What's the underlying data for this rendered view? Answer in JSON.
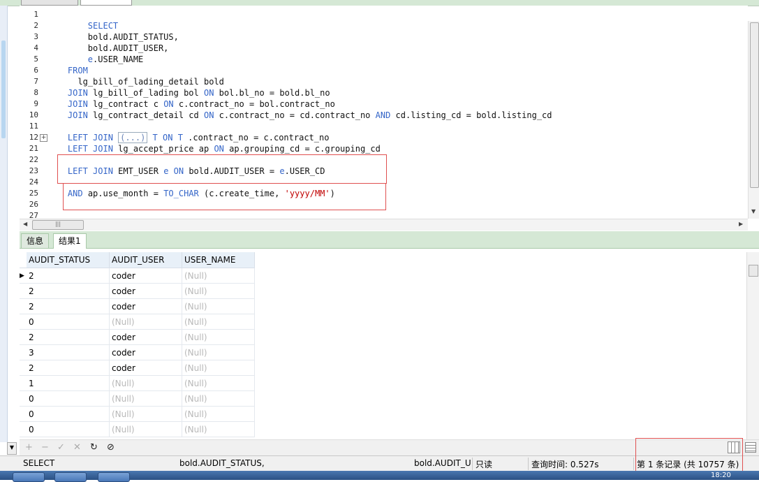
{
  "editor": {
    "line_numbers": [
      "1",
      "2",
      "3",
      "4",
      "5",
      "6",
      "7",
      "8",
      "9",
      "10",
      "11",
      "12",
      "21",
      "22",
      "23",
      "24",
      "25",
      "26",
      "27"
    ],
    "lines": [
      [],
      [
        {
          "t": "        "
        },
        {
          "t": "SELECT",
          "k": true
        }
      ],
      [
        {
          "t": "        bold.AUDIT_STATUS,"
        }
      ],
      [
        {
          "t": "        bold.AUDIT_USER,"
        }
      ],
      [
        {
          "t": "        "
        },
        {
          "t": "e",
          "k": true
        },
        {
          "t": ".USER_NAME"
        }
      ],
      [
        {
          "t": "    "
        },
        {
          "t": "FROM",
          "k": true
        }
      ],
      [
        {
          "t": "      lg_bill_of_lading_detail bold"
        }
      ],
      [
        {
          "t": "    "
        },
        {
          "t": "JOIN",
          "k": true
        },
        {
          "t": " lg_bill_of_lading bol "
        },
        {
          "t": "ON",
          "k": true
        },
        {
          "t": " bol.bl_no = bold.bl_no"
        }
      ],
      [
        {
          "t": "    "
        },
        {
          "t": "JOIN",
          "k": true
        },
        {
          "t": " lg_contract c "
        },
        {
          "t": "ON",
          "k": true
        },
        {
          "t": " c.contract_no = bol.contract_no"
        }
      ],
      [
        {
          "t": "    "
        },
        {
          "t": "JOIN",
          "k": true
        },
        {
          "t": " lg_contract_detail cd "
        },
        {
          "t": "ON",
          "k": true
        },
        {
          "t": " c.contract_no = cd.contract_no "
        },
        {
          "t": "AND",
          "k": true
        },
        {
          "t": " cd.listing_cd = bold.listing_cd"
        }
      ],
      [],
      [
        {
          "t": "    "
        },
        {
          "t": "LEFT JOIN",
          "k": true
        },
        {
          "t": " "
        },
        {
          "t": "(...)",
          "b": true
        },
        {
          "t": " "
        },
        {
          "t": "T",
          "k": true
        },
        {
          "t": " "
        },
        {
          "t": "ON",
          "k": true
        },
        {
          "t": " "
        },
        {
          "t": "T",
          "k": true
        },
        {
          "t": " .contract_no = c.contract_no"
        }
      ],
      [
        {
          "t": "    "
        },
        {
          "t": "LEFT JOIN",
          "k": true
        },
        {
          "t": " lg_accept_price ap "
        },
        {
          "t": "ON",
          "k": true
        },
        {
          "t": " ap.grouping_cd = c.grouping_cd"
        }
      ],
      [],
      [
        {
          "t": "    "
        },
        {
          "t": "LEFT JOIN",
          "k": true
        },
        {
          "t": " EMT_USER "
        },
        {
          "t": "e",
          "k": true
        },
        {
          "t": " "
        },
        {
          "t": "ON",
          "k": true
        },
        {
          "t": " bold.AUDIT_USER = "
        },
        {
          "t": "e",
          "k": true
        },
        {
          "t": ".USER_CD"
        }
      ],
      [],
      [
        {
          "t": "    "
        },
        {
          "t": "AND",
          "k": true
        },
        {
          "t": " ap.use_month = "
        },
        {
          "t": "TO_CHAR",
          "k": true
        },
        {
          "t": " (c.create_time, "
        },
        {
          "t": "'yyyy/MM'",
          "s": true
        },
        {
          "t": ")"
        }
      ],
      [],
      []
    ],
    "fold_marker": "+"
  },
  "result_tabs": [
    {
      "label": "信息",
      "active": false
    },
    {
      "label": "结果1",
      "active": true
    }
  ],
  "grid": {
    "columns": [
      "AUDIT_STATUS",
      "AUDIT_USER",
      "USER_NAME"
    ],
    "rows": [
      [
        "2",
        "coder",
        "(Null)"
      ],
      [
        "2",
        "coder",
        "(Null)"
      ],
      [
        "2",
        "coder",
        "(Null)"
      ],
      [
        "0",
        "(Null)",
        "(Null)"
      ],
      [
        "2",
        "coder",
        "(Null)"
      ],
      [
        "3",
        "coder",
        "(Null)"
      ],
      [
        "2",
        "coder",
        "(Null)"
      ],
      [
        "1",
        "(Null)",
        "(Null)"
      ],
      [
        "0",
        "(Null)",
        "(Null)"
      ],
      [
        "0",
        "(Null)",
        "(Null)"
      ],
      [
        "0",
        "(Null)",
        "(Null)"
      ]
    ],
    "current_row_marker": "▶"
  },
  "toolbar": {
    "add": "+",
    "delete": "−",
    "apply": "✓",
    "cancel": "✕",
    "refresh": "↻",
    "stop": "⊘"
  },
  "status": {
    "sql": "SELECT",
    "field": "bold.AUDIT_STATUS,",
    "field2": "bold.AUDIT_U",
    "mode": "只读",
    "query_time": "查询时间: 0.527s",
    "record": "第 1 条记录 (共 10757 条)"
  },
  "taskbar": {
    "clock": "18:20"
  }
}
